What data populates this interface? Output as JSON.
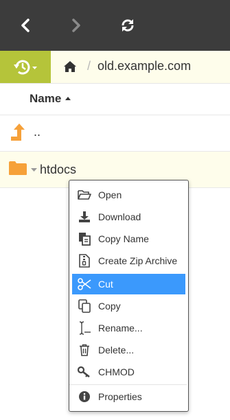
{
  "toolbar": {
    "back_icon": "chevron-left-icon",
    "forward_icon": "chevron-right-icon",
    "refresh_icon": "refresh-icon"
  },
  "breadcrumb": {
    "history_icon": "history-icon",
    "home_icon": "home-icon",
    "separator": "/",
    "host": "old.example.com"
  },
  "list": {
    "column_header": "Name",
    "rows": [
      {
        "name": "..",
        "icon": "level-up-icon"
      },
      {
        "name": "htdocs",
        "icon": "folder-icon"
      }
    ]
  },
  "context_menu": {
    "items": [
      {
        "label": "Open",
        "icon": "folder-open-icon"
      },
      {
        "label": "Download",
        "icon": "download-icon"
      },
      {
        "label": "Copy Name",
        "icon": "copy-name-icon"
      },
      {
        "label": "Create Zip Archive",
        "icon": "zip-file-icon"
      },
      {
        "label": "Cut",
        "icon": "scissors-icon",
        "highlighted": true
      },
      {
        "label": "Copy",
        "icon": "copy-icon"
      },
      {
        "label": "Rename...",
        "icon": "text-cursor-icon"
      },
      {
        "label": "Delete...",
        "icon": "trash-icon"
      },
      {
        "label": "CHMOD",
        "icon": "key-icon"
      },
      {
        "label": "Properties",
        "icon": "info-icon"
      }
    ]
  },
  "colors": {
    "topbar": "#3c3c3c",
    "history_button": "#b5c43a",
    "breadcrumb_bg": "#fefdeb",
    "accent_orange": "#f6a13a",
    "highlight": "#3b99fc"
  }
}
